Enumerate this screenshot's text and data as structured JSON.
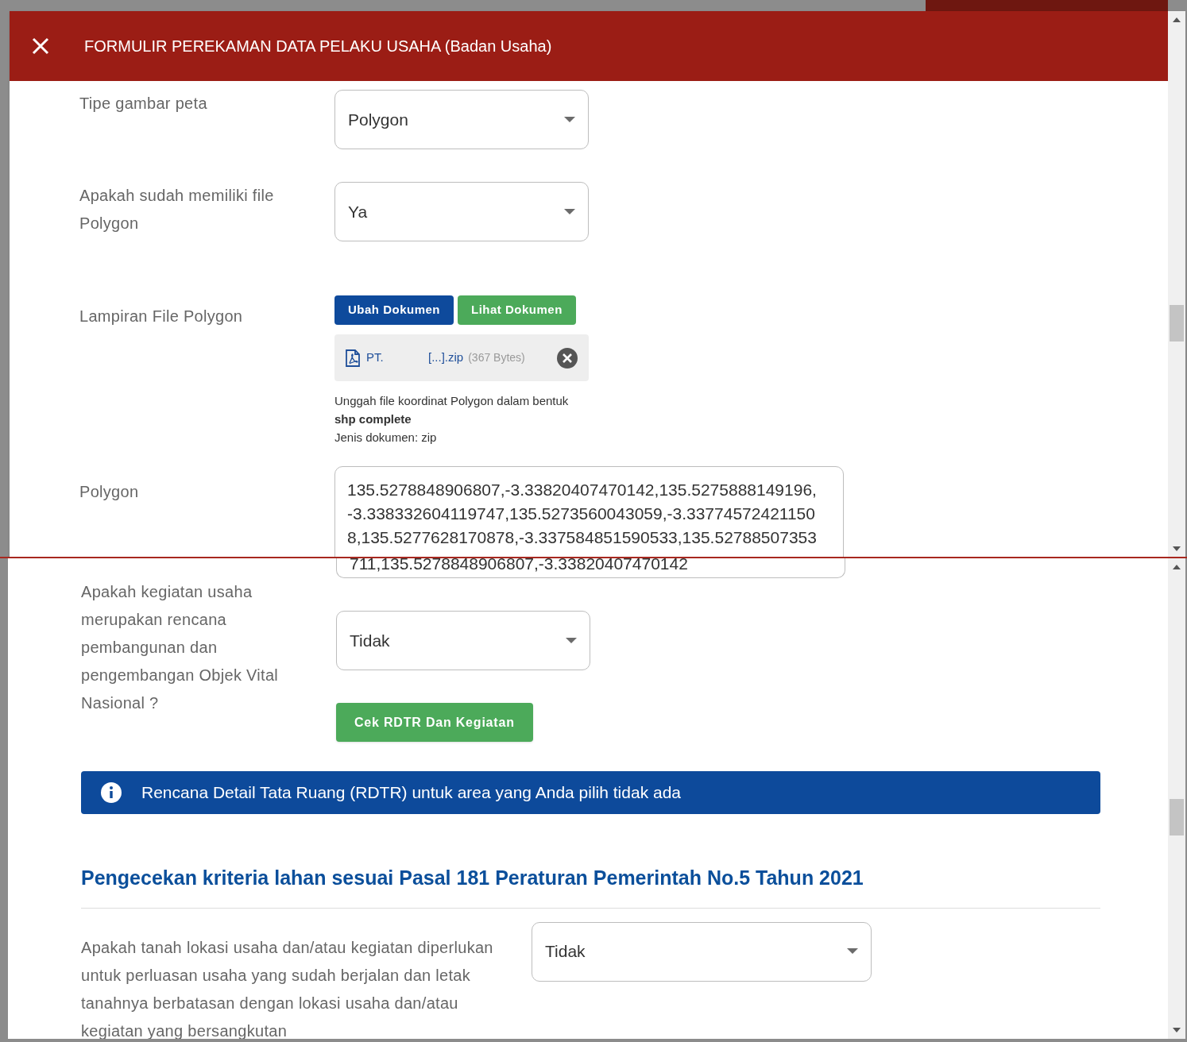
{
  "dialog": {
    "title": "FORMULIR PEREKAMAN DATA PELAKU USAHA (Badan Usaha)"
  },
  "top_panel": {
    "fields": [
      {
        "kind": "select",
        "label": "Tipe gambar peta",
        "value": "Polygon"
      },
      {
        "kind": "select",
        "label": "Apakah sudah memiliki file Polygon",
        "value": "Ya"
      },
      {
        "kind": "upload",
        "label": "Lampiran File Polygon",
        "buttons": [
          {
            "label": "Ubah Dokumen",
            "kind": "primary"
          },
          {
            "label": "Lihat Dokumen",
            "kind": "success"
          }
        ],
        "file": {
          "name": "PT.",
          "name_end": "[...].zip",
          "size": "(367 Bytes)"
        },
        "hint": "Unggah file koordinat Polygon dalam bentuk **shp complete**",
        "doc_type": "Jenis dokumen: zip"
      },
      {
        "kind": "textarea",
        "label": "Polygon",
        "lines": [
          "135.5278848906807,-3.33820407470142,135.5275888149196,",
          "-3.338332604119747,135.5273560043059,-3.33774572421150",
          "8,135.5277628170878,-3.337584851590533,135.52788507353"
        ]
      }
    ]
  },
  "bottom_panel": {
    "textarea_tail": "711,135.5278848906807,-3.33820407470142",
    "question": {
      "label": "Apakah kegiatan usaha merupakan rencana pembangunan dan pengembangan Objek Vital Nasional ?",
      "value": "Tidak",
      "button": "Cek RDTR Dan Kegiatan"
    },
    "alert": "Rencana Detail Tata Ruang (RDTR) untuk area yang Anda pilih tidak ada",
    "section_title": "Pengecekan kriteria lahan sesuai Pasal 181 Peraturan Pemerintah No.5 Tahun 2021",
    "criteria": [
      {
        "label": "Apakah tanah lokasi usaha dan/atau kegiatan diperlukan untuk perluasan usaha yang sudah berjalan dan letak tanahnya berbatasan dengan lokasi usaha dan/atau kegiatan yang bersangkutan",
        "value": "Tidak"
      }
    ]
  }
}
